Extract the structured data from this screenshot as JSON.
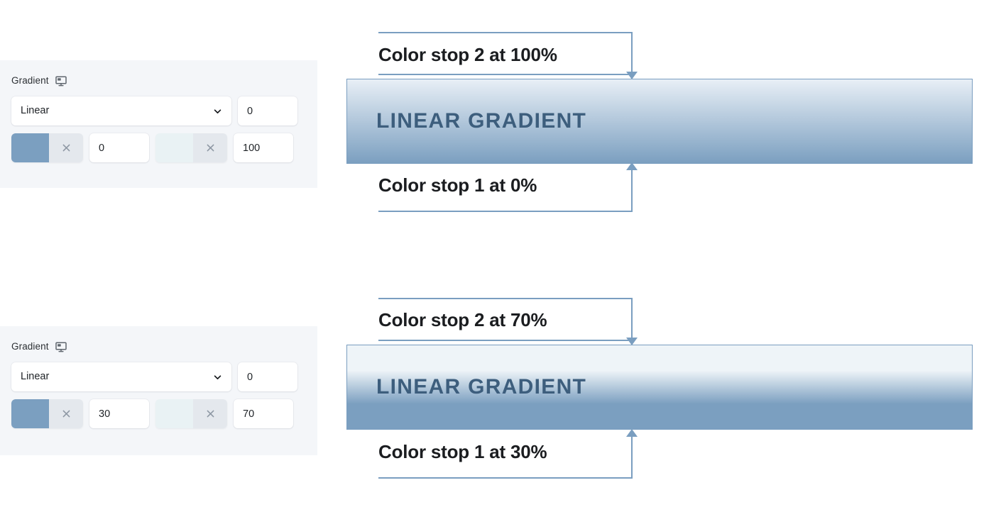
{
  "panels": [
    {
      "label": "Gradient",
      "device_icon": "monitor-icon",
      "type_value": "Linear",
      "angle_value": "0",
      "stops": [
        {
          "color": "#7b9fc0",
          "position": "0",
          "clear_icon": "close-icon"
        },
        {
          "color": "#e9f2f4",
          "position": "100",
          "clear_icon": "close-icon"
        }
      ]
    },
    {
      "label": "Gradient",
      "device_icon": "monitor-icon",
      "type_value": "Linear",
      "angle_value": "0",
      "stops": [
        {
          "color": "#7b9fc0",
          "position": "30",
          "clear_icon": "close-icon"
        },
        {
          "color": "#e9f2f4",
          "position": "70",
          "clear_icon": "close-icon"
        }
      ]
    }
  ],
  "previews": [
    {
      "text": "LINEAR GRADIENT",
      "text_color": "#3d5e7d",
      "border_color": "#7a9ec0",
      "top_color": "#e8eff6",
      "bottom_color": "#7b9fc0",
      "stop1_percent": 0,
      "stop2_percent": 100
    },
    {
      "text": "LINEAR GRADIENT",
      "text_color": "#3d5e7d",
      "border_color": "#7a9ec0",
      "top_color": "#eef4f8",
      "bottom_color": "#7b9fc0",
      "stop1_percent": 30,
      "stop2_percent": 70
    }
  ],
  "annotations": [
    {
      "text": "Color stop 2 at 100%",
      "arrow": "down",
      "line_color": "#7a9ec0"
    },
    {
      "text": "Color stop 1 at 0%",
      "arrow": "up",
      "line_color": "#7a9ec0"
    },
    {
      "text": "Color stop 2 at 70%",
      "arrow": "down",
      "line_color": "#7a9ec0"
    },
    {
      "text": "Color stop 1 at 30%",
      "arrow": "up",
      "line_color": "#7a9ec0"
    }
  ]
}
